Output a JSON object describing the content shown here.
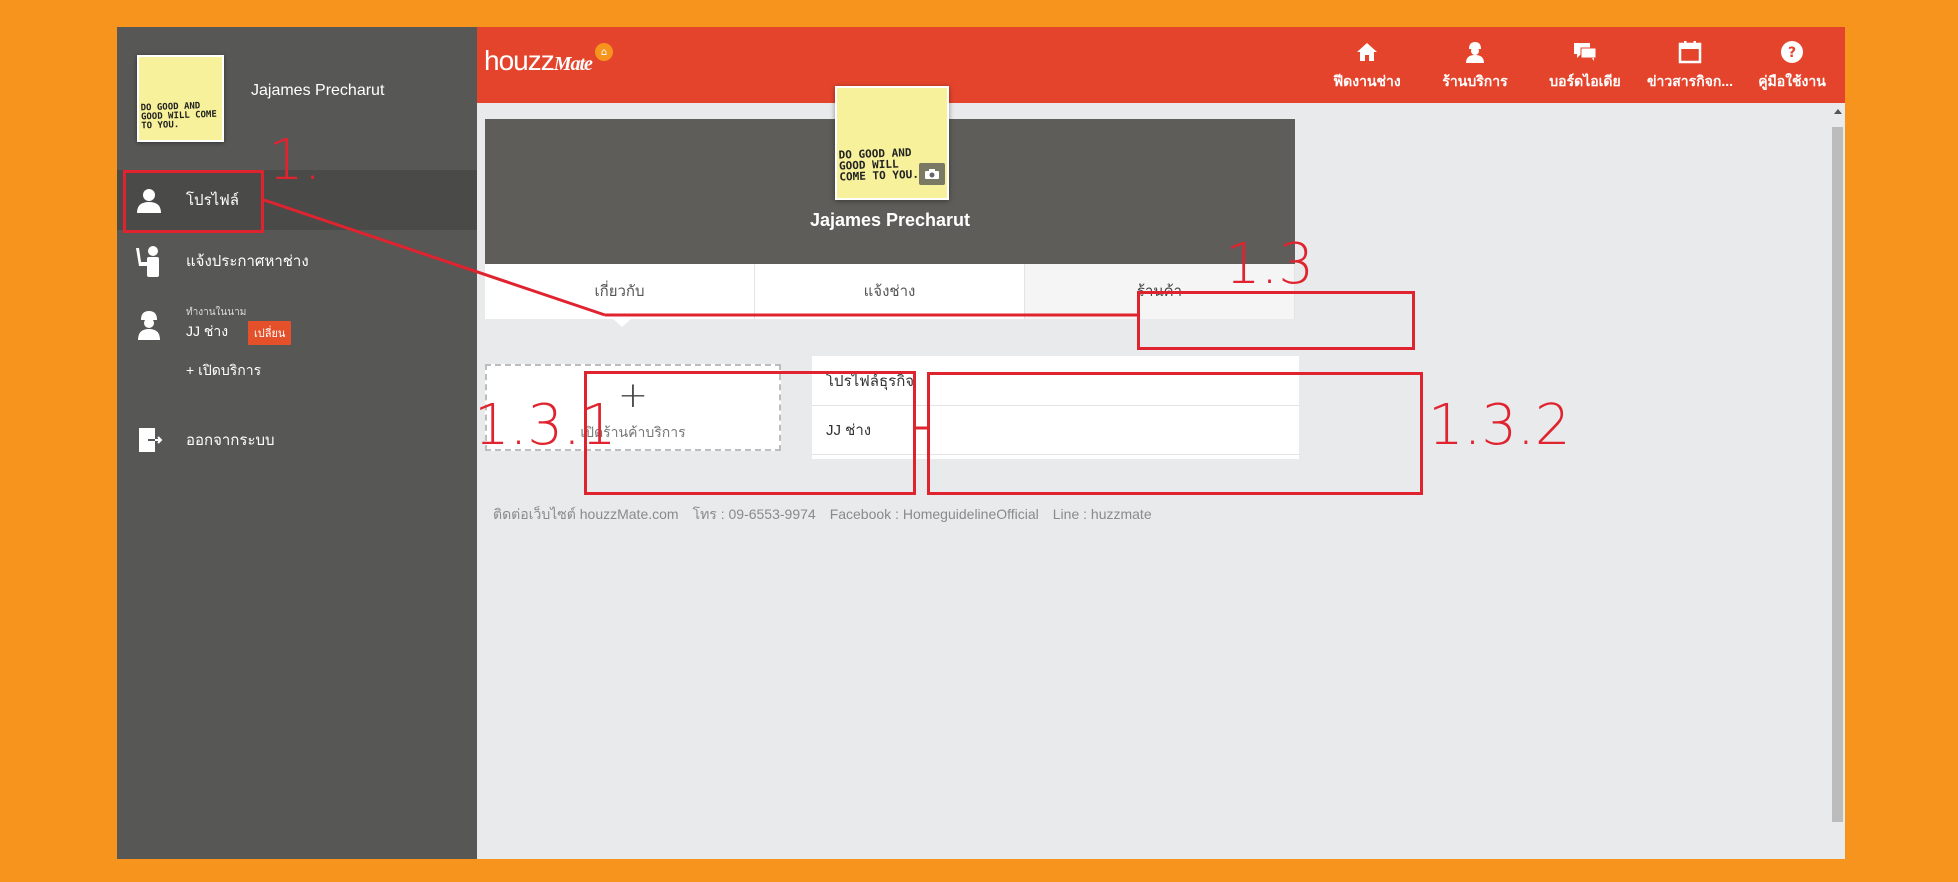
{
  "user": {
    "name": "Jajames Precharut",
    "avatar_note_text": "DO GOOD AND GOOD WILL COME TO YOU."
  },
  "sidebar": {
    "items": [
      {
        "label": "โปรไฟล์",
        "icon": "user-icon"
      },
      {
        "label": "แจ้งประกาศหาช่าง",
        "icon": "worker-hand-icon"
      },
      {
        "label": "JJ ช่าง",
        "sub_label": "ทำงานในนาม",
        "icon": "technician-icon",
        "change_label": "เปลี่ยน"
      },
      {
        "label": "ออกจากระบบ",
        "icon": "logout-icon"
      }
    ],
    "open_service_label": "+ เปิดบริการ"
  },
  "header": {
    "logo_houzz": "houzz",
    "logo_mate": "Mate",
    "nav": [
      {
        "label": "ฟีดงานช่าง",
        "icon": "home-icon"
      },
      {
        "label": "ร้านบริการ",
        "icon": "service-shop-icon"
      },
      {
        "label": "บอร์ดไอเดีย",
        "icon": "chat-bubble-icon"
      },
      {
        "label": "ข่าวสารกิจก...",
        "icon": "calendar-icon"
      },
      {
        "label": "คู่มือใช้งาน",
        "icon": "help-icon"
      }
    ]
  },
  "profile": {
    "tabs": [
      {
        "label": "เกี่ยวกับ"
      },
      {
        "label": "แจ้งช่าง"
      },
      {
        "label": "ร้านค้า"
      }
    ],
    "open_shop_label": "เปิดร้านค้าบริการ",
    "businesses": [
      {
        "label": "โปรไฟล์ธุรกิจ"
      },
      {
        "label": "JJ ช่าง"
      }
    ]
  },
  "footer": {
    "website": "ติดต่อเว็บไซต์ houzzMate.com",
    "phone": "โทร : 09-6553-9974",
    "facebook": "Facebook : HomeguidelineOfficial",
    "line": "Line : huzzmate"
  },
  "annotations": {
    "a1": "1.",
    "a13": "1.3",
    "a131": "1.3.1",
    "a132": "1.3.2"
  },
  "colors": {
    "background": "#f7941d",
    "header": "#e4442c",
    "sidebar": "#575756",
    "annotation": "#e0242f",
    "change_button": "#e4502a"
  }
}
